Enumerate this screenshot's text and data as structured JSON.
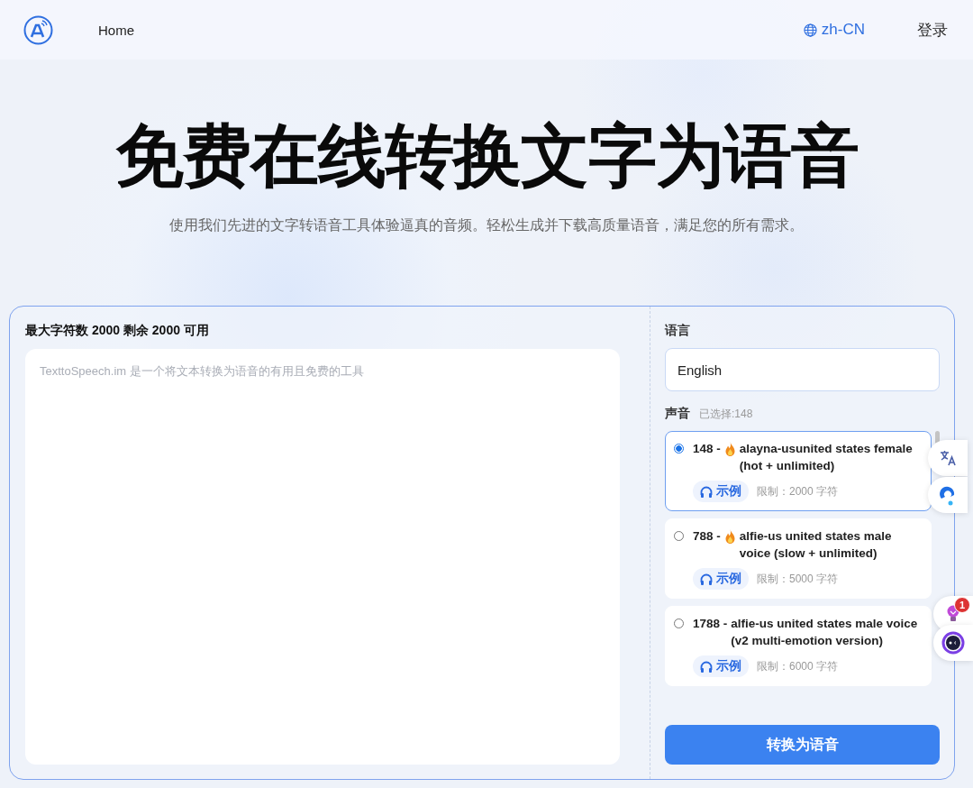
{
  "header": {
    "nav": [
      {
        "label": "Home"
      }
    ],
    "language": "zh-CN",
    "login": "登录"
  },
  "hero": {
    "title": "免费在线转换文字为语音",
    "subtitle": "使用我们先进的文字转语音工具体验逼真的音频。轻松生成并下载高质量语音，满足您的所有需求。"
  },
  "editor": {
    "limit_text": "最大字符数 2000 剩余 2000 可用",
    "placeholder": "TexttoSpeech.im 是一个将文本转换为语音的有用且免费的工具"
  },
  "settings": {
    "language_label": "语言",
    "language_value": "English",
    "voice_label": "声音",
    "voice_selected": "已选择:148",
    "voices": [
      {
        "number": "148 -",
        "hot": true,
        "name": "alayna-usunited states female (hot + unlimited)",
        "sample": "示例",
        "limit": "限制：2000 字符",
        "selected": true
      },
      {
        "number": "788 -",
        "hot": true,
        "name": "alfie-us united states male voice (slow + unlimited)",
        "sample": "示例",
        "limit": "限制：5000 字符",
        "selected": false
      },
      {
        "number": "1788 -",
        "hot": false,
        "name": "alfie-us united states male voice (v2 multi-emotion version)",
        "sample": "示例",
        "limit": "限制：6000 字符",
        "selected": false
      }
    ],
    "convert_button": "转换为语音"
  },
  "side_widgets": [
    {
      "kind": "translate"
    },
    {
      "kind": "logo"
    },
    {
      "kind": "bulb",
      "badge": "1"
    },
    {
      "kind": "face"
    }
  ]
}
